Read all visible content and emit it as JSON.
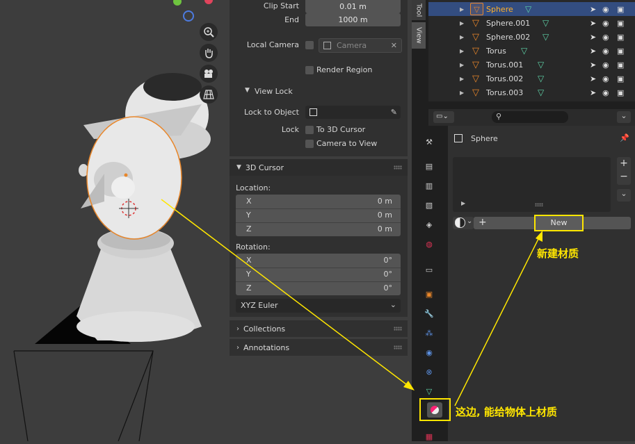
{
  "viewport": {
    "nav_icons": [
      "zoom-icon",
      "hand-pan-icon",
      "camera-view-icon",
      "grid-persp-icon"
    ]
  },
  "view_panel": {
    "clip_start_label": "Clip Start",
    "clip_start_value": "0.01 m",
    "end_label": "End",
    "end_value": "1000 m",
    "local_camera_label": "Local Camera",
    "camera_placeholder": "Camera",
    "render_region_label": "Render Region",
    "view_lock_header": "View Lock",
    "lock_to_object_label": "Lock to Object",
    "lock_label": "Lock",
    "to_3d_cursor_label": "To 3D Cursor",
    "camera_to_view_label": "Camera to View"
  },
  "cursor_panel": {
    "header": "3D Cursor",
    "location_label": "Location:",
    "location": [
      {
        "axis": "X",
        "value": "0 m"
      },
      {
        "axis": "Y",
        "value": "0 m"
      },
      {
        "axis": "Z",
        "value": "0 m"
      }
    ],
    "rotation_label": "Rotation:",
    "rotation": [
      {
        "axis": "X",
        "value": "0°"
      },
      {
        "axis": "Y",
        "value": "0°"
      },
      {
        "axis": "Z",
        "value": "0°"
      }
    ],
    "rotation_mode": "XYZ Euler"
  },
  "collections_header": "Collections",
  "annotations_header": "Annotations",
  "side_tabs": {
    "tool": "Tool",
    "view": "View"
  },
  "outliner": {
    "items": [
      {
        "name": "Sphere",
        "selected": true
      },
      {
        "name": "Sphere.001",
        "selected": false
      },
      {
        "name": "Sphere.002",
        "selected": false
      },
      {
        "name": "Torus",
        "selected": false
      },
      {
        "name": "Torus.001",
        "selected": false
      },
      {
        "name": "Torus.002",
        "selected": false
      },
      {
        "name": "Torus.003",
        "selected": false
      }
    ]
  },
  "properties": {
    "object_name": "Sphere",
    "new_button": "New",
    "add_symbol": "+",
    "remove_symbol": "−",
    "tabs": [
      "tool-icon",
      "render-icon",
      "output-icon",
      "view-layer-icon",
      "scene-icon",
      "world-icon",
      "collection-icon",
      "object-icon",
      "modifier-icon",
      "particles-icon",
      "physics-icon",
      "constraints-icon",
      "data-icon",
      "material-icon",
      "texture-icon"
    ]
  },
  "annotations": {
    "new_material": "新建材质",
    "material_tab": "这边, 能给物体上材质"
  },
  "colors": {
    "accent_orange": "#e8862a",
    "highlight_yellow": "#ffe600",
    "selected_row": "#334d80",
    "mesh_green": "#5fd3a8"
  }
}
